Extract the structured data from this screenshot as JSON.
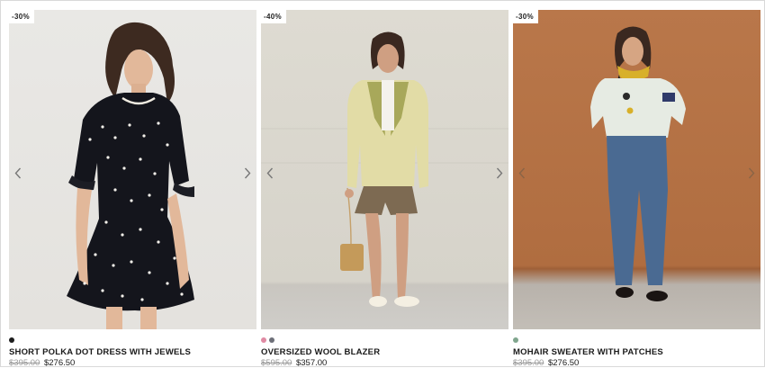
{
  "products": [
    {
      "discount": "-30%",
      "name": "SHORT POLKA DOT DRESS WITH JEWELS",
      "old_price": "$395.00",
      "new_price": "$276.50",
      "swatches": [
        "#1c1c1c"
      ]
    },
    {
      "discount": "-40%",
      "name": "OVERSIZED WOOL BLAZER",
      "old_price": "$595.00",
      "new_price": "$357.00",
      "swatches": [
        "#e08aa3",
        "#6d6f78"
      ]
    },
    {
      "discount": "-30%",
      "name": "MOHAIR SWEATER WITH PATCHES",
      "old_price": "$395.00",
      "new_price": "$276.50",
      "swatches": [
        "#7fa58d"
      ]
    }
  ],
  "icons": {
    "prev": "chevron-left-icon",
    "next": "chevron-right-icon"
  }
}
